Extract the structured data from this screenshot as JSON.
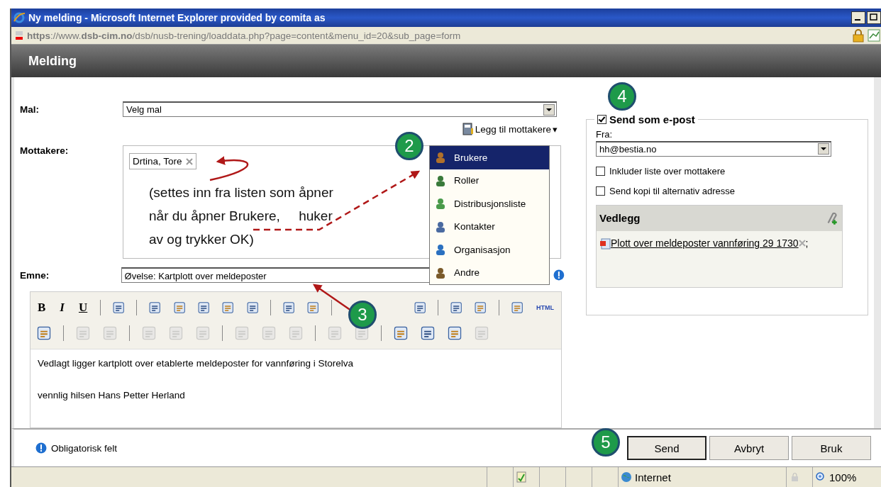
{
  "window": {
    "title": "Ny melding - Microsoft Internet Explorer provided by comita as"
  },
  "address_bar": {
    "url": "**https**://www.**dsb-cim.no**/dsb/nusb-trening/loaddata.php?page=content&menu_id=20&sub_page=form"
  },
  "page_header": "Melding",
  "form": {
    "template": {
      "label": "Mal:",
      "value": "Velg mal"
    },
    "recipients": {
      "label": "Mottakere:",
      "add_button": "Legg til mottakere",
      "add_caret": "▾",
      "tokens": [
        {
          "name": "Drtina, Tore"
        }
      ],
      "menu": [
        {
          "label": "Brukere",
          "selected": true
        },
        {
          "label": "Roller",
          "selected": false
        },
        {
          "label": "Distribusjonsliste",
          "selected": false
        },
        {
          "label": "Kontakter",
          "selected": false
        },
        {
          "label": "Organisasjon",
          "selected": false
        },
        {
          "label": "Andre",
          "selected": false
        }
      ]
    },
    "subject": {
      "label": "Emne:",
      "value": "Øvelse: Kartplott over meldeposter"
    },
    "toolbar": [
      [
        {
          "kind": "text",
          "label": "B"
        },
        {
          "kind": "text",
          "label": "I"
        },
        {
          "kind": "text",
          "label": "U"
        },
        {
          "kind": "sep"
        },
        {
          "kind": "icon",
          "disabled": false
        },
        {
          "kind": "sep"
        },
        {
          "kind": "icon",
          "disabled": false
        },
        {
          "kind": "icon",
          "disabled": false
        },
        {
          "kind": "icon",
          "disabled": false
        },
        {
          "kind": "icon",
          "disabled": false
        },
        {
          "kind": "icon",
          "disabled": false
        },
        {
          "kind": "sep"
        },
        {
          "kind": "icon",
          "disabled": false
        },
        {
          "kind": "icon",
          "disabled": false
        },
        {
          "kind": "sep"
        },
        {
          "kind": "gap"
        },
        {
          "kind": "icon",
          "disabled": false
        },
        {
          "kind": "sep"
        },
        {
          "kind": "icon",
          "disabled": false
        },
        {
          "kind": "icon",
          "disabled": false
        },
        {
          "kind": "sep"
        },
        {
          "kind": "icon",
          "disabled": false
        },
        {
          "kind": "text",
          "label": "HTML"
        }
      ],
      [
        {
          "kind": "icon",
          "disabled": false
        },
        {
          "kind": "sep"
        },
        {
          "kind": "icon",
          "disabled": true
        },
        {
          "kind": "icon",
          "disabled": true
        },
        {
          "kind": "sep"
        },
        {
          "kind": "icon",
          "disabled": true
        },
        {
          "kind": "icon",
          "disabled": true
        },
        {
          "kind": "icon",
          "disabled": true
        },
        {
          "kind": "sep"
        },
        {
          "kind": "icon",
          "disabled": true
        },
        {
          "kind": "icon",
          "disabled": true
        },
        {
          "kind": "icon",
          "disabled": true
        },
        {
          "kind": "sep"
        },
        {
          "kind": "icon",
          "disabled": true
        },
        {
          "kind": "icon",
          "disabled": true
        },
        {
          "kind": "sep"
        },
        {
          "kind": "icon",
          "disabled": false
        },
        {
          "kind": "icon",
          "disabled": false
        },
        {
          "kind": "icon",
          "disabled": false
        },
        {
          "kind": "icon",
          "disabled": true
        }
      ]
    ],
    "body": [
      "Vedlagt ligger kartplott over etablerte meldeposter for vannføring i Storelva",
      "vennlig hilsen Hans Petter Herland"
    ]
  },
  "email": {
    "checked": true,
    "label": "Send som e-post",
    "from_label": "Fra:",
    "from_value": "hh@bestia.no",
    "options": [
      {
        "label": "Inkluder liste over mottakere",
        "checked": false
      },
      {
        "label": "Send kopi til alternativ adresse",
        "checked": false
      }
    ],
    "attachments_title": "Vedlegg",
    "attachments": [
      {
        "name": "Plott over meldeposter vannføring 29 1730",
        "separator": ";"
      }
    ]
  },
  "footer": {
    "note": "Obligatorisk felt",
    "buttons": [
      {
        "label": "Send",
        "default": true
      },
      {
        "label": "Avbryt",
        "default": false
      },
      {
        "label": "Bruk",
        "default": false
      }
    ]
  },
  "status_bar": {
    "zone": "Internet",
    "zoom": "100%"
  },
  "annotations": {
    "note": "(settes inn fra listen som åpner\nnår du åpner Brukere,     huker\nav og trykker OK)",
    "steps": [
      "2",
      "3",
      "4",
      "5"
    ]
  }
}
